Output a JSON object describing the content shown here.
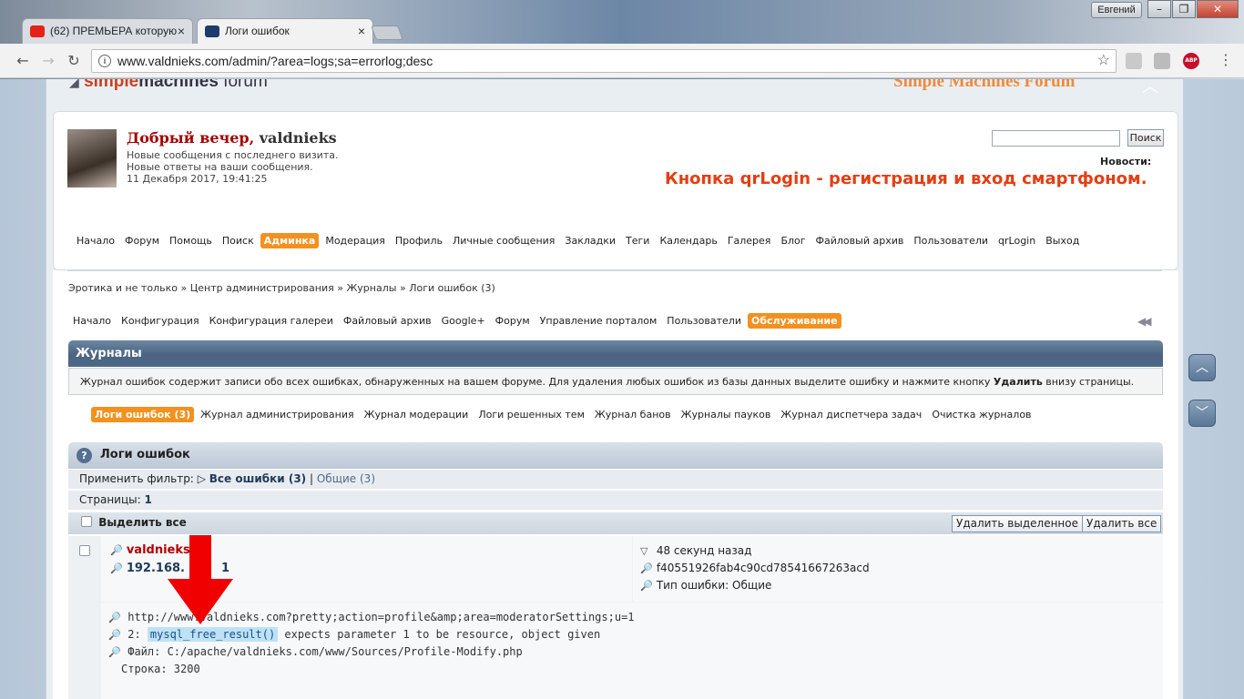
{
  "browser": {
    "tabs": [
      {
        "label": "(62) ПРЕМЬЕРА которую"
      },
      {
        "label": "Логи ошибок"
      }
    ],
    "profile_button": "Евгений",
    "url": "www.valdnieks.com/admin/?area=logs;sa=errorlog;desc",
    "ext_abp": "ABP"
  },
  "site": {
    "logo_part1": "simple",
    "logo_part2": "machines",
    "logo_part3": " forum",
    "logo_right": "Simple Machines Forum"
  },
  "header": {
    "greeting": "Добрый вечер,",
    "username": " valdnieks",
    "info_lines": [
      "Новые сообщения с последнего визита.",
      "Новые ответы на ваши сообщения.",
      "11 Декабря 2017, 19:41:25"
    ],
    "search_button": "Поиск",
    "news_label": "Новости:",
    "news_text": "Кнопка qrLogin - регистрация и вход смартфоном."
  },
  "main_menu": [
    "Начало",
    "Форум",
    "Помощь",
    "Поиск",
    "Админка",
    "Модерация",
    "Профиль",
    "Личные сообщения",
    "Закладки",
    "Теги",
    "Календарь",
    "Галерея",
    "Блог",
    "Файловый архив",
    "Пользователи",
    "qrLogin",
    "Выход"
  ],
  "breadcrumbs": {
    "items": [
      "Эротика и не только",
      "Центр администрирования",
      "Журналы",
      "Логи ошибок (3)"
    ],
    "separator": "»"
  },
  "admin_menu": [
    "Начало",
    "Конфигурация",
    "Конфигурация галереи",
    "Файловый архив",
    "Google+",
    "Форум",
    "Управление порталом",
    "Пользователи",
    "Обслуживание"
  ],
  "logs_section": {
    "title": "Журналы",
    "description_pre": "Журнал ошибок содержит записи обо всех ошибках, обнаруженных на вашем форуме. Для удаления любых ошибок из базы данных выделите ошибку и нажмите кнопку ",
    "description_bold": "Удалить",
    "description_post": " внизу страницы.",
    "tabs": [
      "Логи ошибок (3)",
      "Журнал администрирования",
      "Журнал модерации",
      "Логи решенных тем",
      "Журнал банов",
      "Журналы пауков",
      "Журнал диспетчера задач",
      "Очистка журналов"
    ]
  },
  "error_log": {
    "title": "Логи ошибок",
    "filter_label": "Применить фильтр:",
    "filter_all": "Все ошибки (3)",
    "filter_sep": "|",
    "filter_general": "Общие (3)",
    "pages_label": "Страницы:",
    "pages_value": "1",
    "select_all": "Выделить все",
    "delete_selected": "Удалить выделенное",
    "delete_all": "Удалить все",
    "entry": {
      "user": "valdnieks",
      "ip": "192.168.",
      "ip_tail": "1",
      "time": "48 секунд назад",
      "hash": "f40551926fab4c90cd78541667263acd",
      "type": "Тип ошибки: Общие",
      "url": "http://www.valdnieks.com?pretty;action=profile&amp;area=moderatorSettings;u=1",
      "msg_prefix": "2: ",
      "msg_func": "mysql_free_result()",
      "msg_rest": " expects parameter 1 to be resource, object given",
      "file": "Файл: C:/apache/valdnieks.com/www/Sources/Profile-Modify.php",
      "line": "Строка: 3200"
    }
  },
  "colors": {
    "accent": "#f3911f",
    "title_bar": "#4a6482",
    "news": "#e43e12",
    "highlight": "#bde2f5",
    "arrow": "#f00000"
  }
}
